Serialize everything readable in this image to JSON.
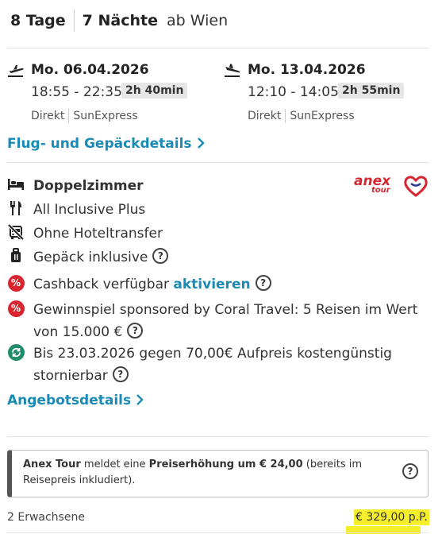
{
  "header": {
    "days": "8 Tage",
    "nights": "7 Nächte",
    "from": "ab Wien"
  },
  "outbound": {
    "date": "Mo. 06.04.2026",
    "time": "18:55 - 22:35",
    "duration": "2h 40min",
    "stops": "Direkt",
    "airline": "SunExpress",
    "icon": "plane-departure-icon"
  },
  "return": {
    "date": "Mo. 13.04.2026",
    "time": "12:10 - 14:05",
    "duration": "2h 55min",
    "stops": "Direkt",
    "airline": "SunExpress",
    "icon": "plane-arrival-icon"
  },
  "flight_link": "Flug- und Gepäckdetails",
  "room": "Doppelzimmer",
  "board": "All Inclusive Plus",
  "transfer": "Ohne Hoteltransfer",
  "luggage": "Gepäck inklusive",
  "cashback": {
    "text": "Cashback verfügbar",
    "action": "aktivieren"
  },
  "raffle": "Gewinnspiel sponsored by Coral Travel: 5 Reisen im Wert von 15.000 €",
  "cancellation": "Bis 23.03.2026 gegen 70,00€ Aufpreis kostengünstig stornierbar",
  "offer_link": "Angebotsdetails",
  "operator_logo": {
    "anex": "anex",
    "tour": "tour"
  },
  "notice": {
    "operator": "Anex Tour",
    "middle": " meldet eine ",
    "highlight": "Preiserhöhung um € 24,00",
    "tail": " (bereits im Reisepreis inkludiert)."
  },
  "travellers": "2 Erwachsene",
  "price": "€ 329,00 p.P.",
  "colors": {
    "accent": "#1a8bb5",
    "red": "#d7262f",
    "green": "#1f8c6a",
    "highlight": "#f5ee2a"
  }
}
